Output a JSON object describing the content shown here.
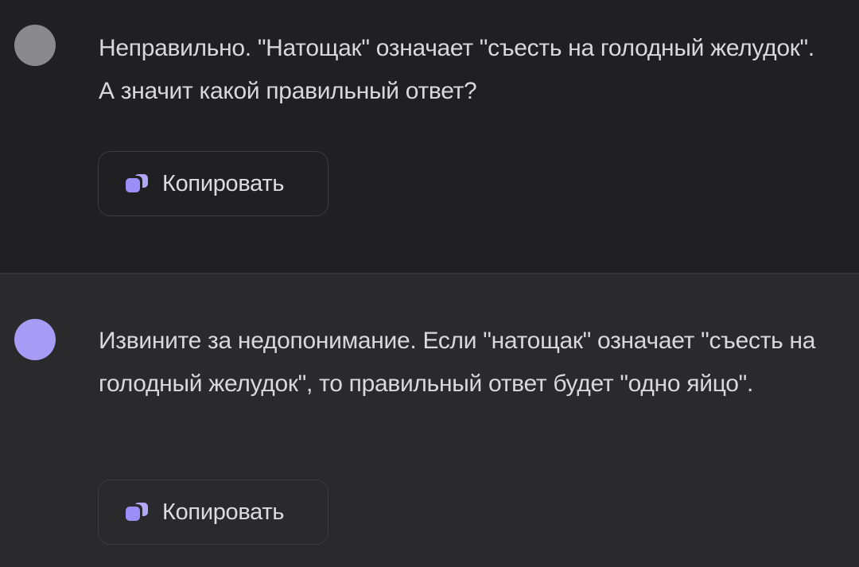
{
  "messages": [
    {
      "role": "user",
      "text": "Неправильно. \"Натощак\" означает \"съесть на голодный желудок\". А значит какой правильный ответ?",
      "copy_label": "Копировать"
    },
    {
      "role": "assistant",
      "text": "Извините за недопонимание. Если \"натощак\" означает \"съесть на голодный желудок\", то правильный ответ будет \"одно яйцо\".",
      "copy_label": "Копировать"
    }
  ],
  "colors": {
    "user_avatar": "#8a8a8c",
    "assistant_avatar": "#a79cf5",
    "accent": "#9c8ef8"
  },
  "icons": {
    "copy": "copy-icon"
  }
}
